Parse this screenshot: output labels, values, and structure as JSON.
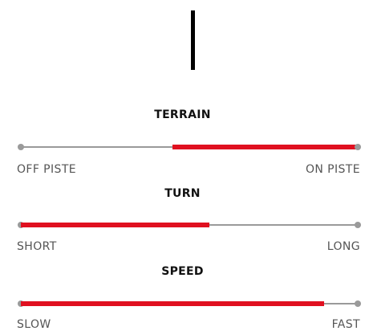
{
  "sliders": [
    {
      "title": "TERRAIN",
      "left_label": "OFF PISTE",
      "right_label": "ON PISTE",
      "fill_start": 0.45,
      "fill_end": 1.0
    },
    {
      "title": "TURN",
      "left_label": "SHORT",
      "right_label": "LONG",
      "fill_start": 0.0,
      "fill_end": 0.56
    },
    {
      "title": "SPEED",
      "left_label": "SLOW",
      "right_label": "FAST",
      "fill_start": 0.0,
      "fill_end": 0.9
    }
  ],
  "colors": {
    "fill": "#e01020",
    "track": "#9a9a9a",
    "divider": "#000000"
  }
}
